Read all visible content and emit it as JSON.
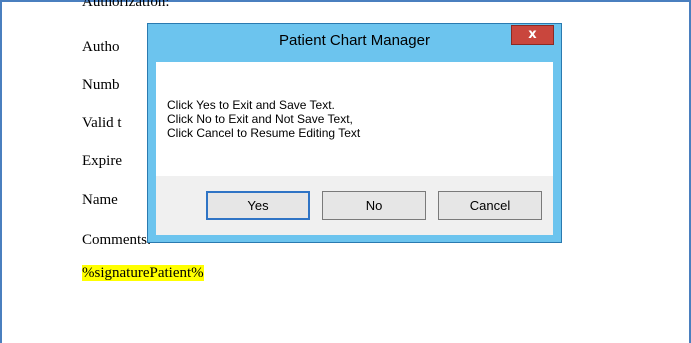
{
  "document": {
    "line_cut": "Authorization:",
    "line_author": "Autho",
    "line_number": "Numb",
    "line_valid": "Valid t",
    "line_expire": "Expire",
    "line_name": "Name",
    "line_comments": "Comments:",
    "signature_placeholder": "%signaturePatient%"
  },
  "dialog": {
    "title": "Patient Chart Manager",
    "close_label": "x",
    "message_lines": [
      "Click Yes to Exit and Save Text.",
      "Click No to Exit and Not Save Text,",
      "Click Cancel to Resume Editing Text"
    ],
    "buttons": {
      "yes": "Yes",
      "no": "No",
      "cancel": "Cancel"
    }
  },
  "colors": {
    "titlebar": "#6cc4ee",
    "close_button": "#c9463d",
    "highlight": "#ffff00",
    "default_button_border": "#2f74c5"
  }
}
